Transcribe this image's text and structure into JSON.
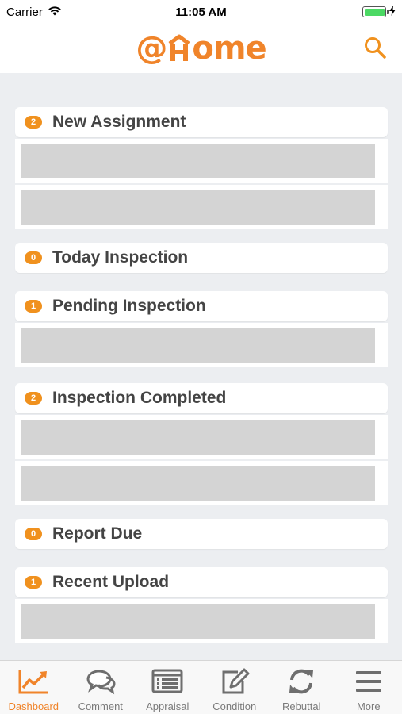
{
  "status_bar": {
    "carrier": "Carrier",
    "time": "11:05 AM"
  },
  "header": {
    "logo_prefix": "@",
    "logo_suffix": "ome",
    "accent_color": "#f0842a"
  },
  "sections": [
    {
      "title": "New Assignment",
      "count": "2",
      "rows": 2
    },
    {
      "title": "Today Inspection",
      "count": "0",
      "rows": 0
    },
    {
      "title": "Pending Inspection",
      "count": "1",
      "rows": 1
    },
    {
      "title": "Inspection Completed",
      "count": "2",
      "rows": 2
    },
    {
      "title": "Report Due",
      "count": "0",
      "rows": 0
    },
    {
      "title": "Recent Upload",
      "count": "1",
      "rows": 1
    }
  ],
  "tabs": [
    {
      "label": "Dashboard",
      "icon": "chart-icon",
      "active": true
    },
    {
      "label": "Comment",
      "icon": "chat-bubbles-icon",
      "active": false
    },
    {
      "label": "Appraisal",
      "icon": "list-icon",
      "active": false
    },
    {
      "label": "Condition",
      "icon": "edit-icon",
      "active": false
    },
    {
      "label": "Rebuttal",
      "icon": "refresh-icon",
      "active": false
    },
    {
      "label": "More",
      "icon": "menu-icon",
      "active": false
    }
  ]
}
